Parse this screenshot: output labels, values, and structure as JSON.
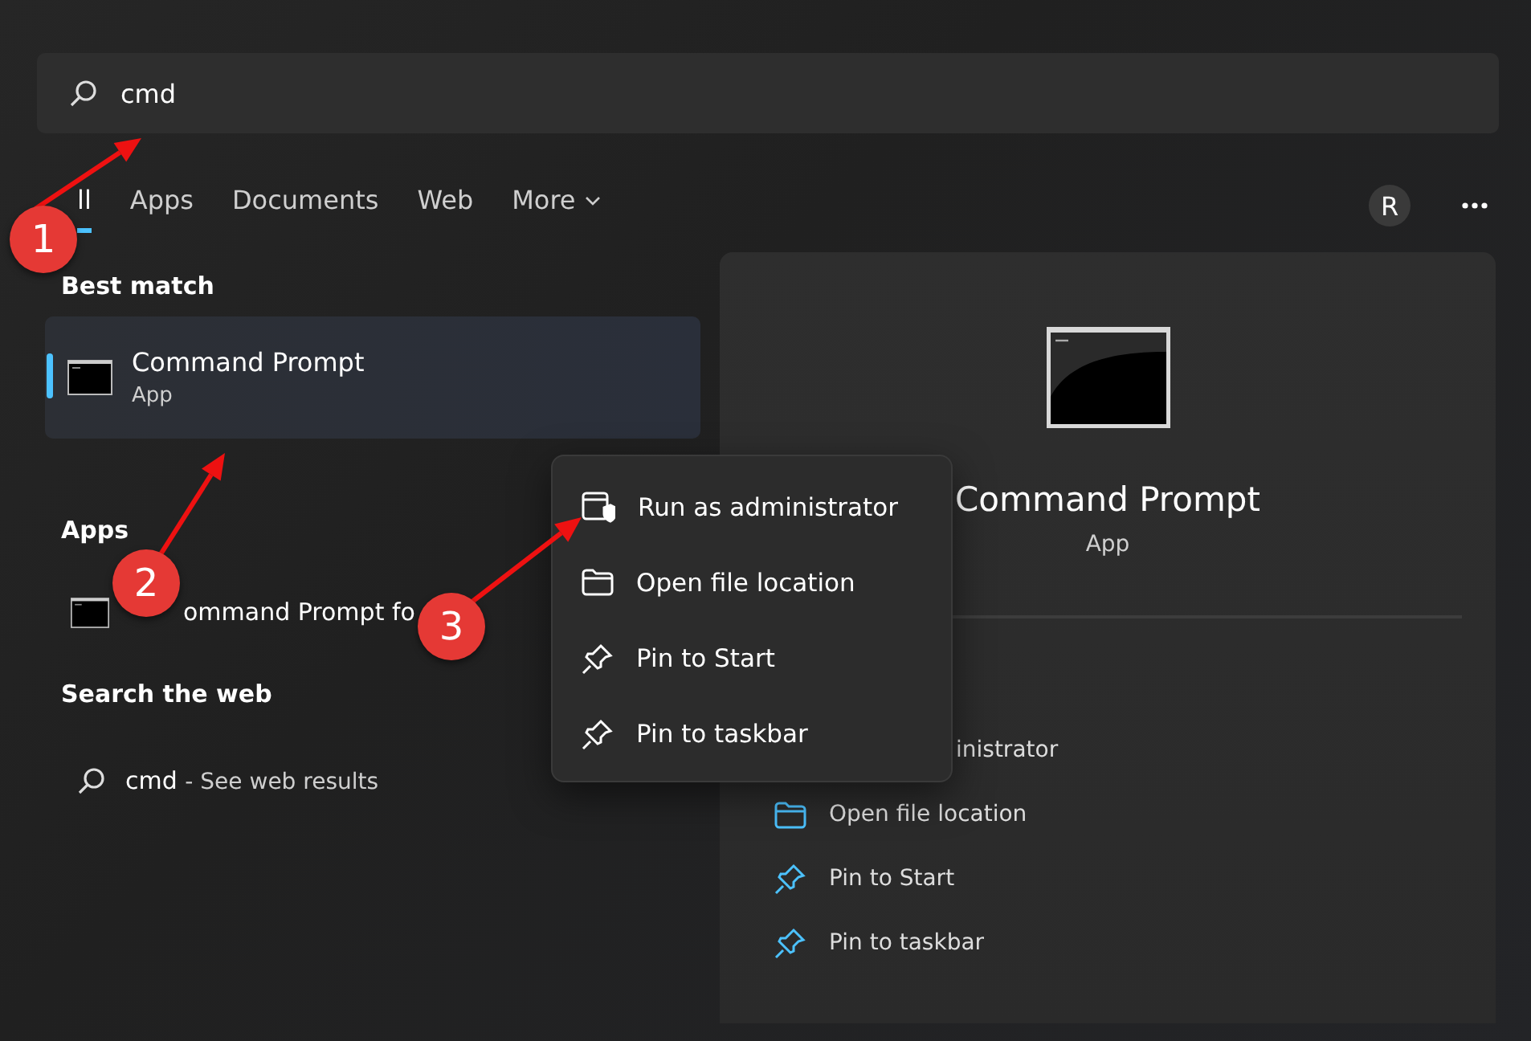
{
  "search": {
    "value": "cmd"
  },
  "tabs": [
    {
      "label": "ll",
      "selected": true,
      "kind": "plain"
    },
    {
      "label": "Apps",
      "selected": false,
      "kind": "plain"
    },
    {
      "label": "Documents",
      "selected": false,
      "kind": "plain"
    },
    {
      "label": "Web",
      "selected": false,
      "kind": "plain"
    },
    {
      "label": "More",
      "selected": false,
      "kind": "dropdown"
    }
  ],
  "avatar": "R",
  "best_match": {
    "heading": "Best match",
    "title": "Command Prompt",
    "subtitle": "App",
    "selected": true
  },
  "apps": {
    "heading": "Apps",
    "items": [
      {
        "title": "ommand Prompt fo"
      }
    ]
  },
  "web": {
    "heading": "Search the web",
    "query": "cmd",
    "hint": "- See web results"
  },
  "detail": {
    "title": "Command Prompt",
    "subtitle": "App",
    "actions": [
      {
        "label": "inistrator",
        "kind": "partial"
      },
      {
        "label": "Open file location",
        "kind": "folder"
      },
      {
        "label": "Pin to Start",
        "kind": "pin"
      },
      {
        "label": "Pin to taskbar",
        "kind": "pin"
      }
    ]
  },
  "context_menu": [
    {
      "label": "Run as administrator",
      "kind": "shield"
    },
    {
      "label": "Open file location",
      "kind": "folder"
    },
    {
      "label": "Pin to Start",
      "kind": "pin"
    },
    {
      "label": "Pin to taskbar",
      "kind": "pin"
    }
  ],
  "annotations": [
    "1",
    "2",
    "3"
  ]
}
